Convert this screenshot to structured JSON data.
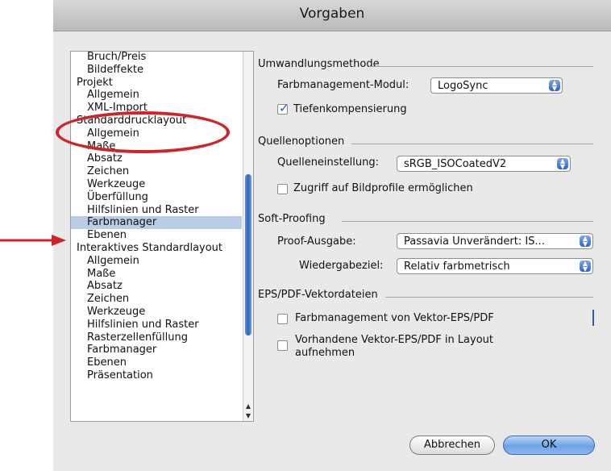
{
  "window": {
    "title": "Vorgaben"
  },
  "tree": [
    {
      "label": "Bruch/Preis",
      "level": 1
    },
    {
      "label": "Bildeffekte",
      "level": 1
    },
    {
      "label": "Projekt",
      "level": 0
    },
    {
      "label": "Allgemein",
      "level": 1
    },
    {
      "label": "XML-Import",
      "level": 1
    },
    {
      "label": "Standarddrucklayout",
      "level": 0
    },
    {
      "label": "Allgemein",
      "level": 1
    },
    {
      "label": "Maße",
      "level": 1
    },
    {
      "label": "Absatz",
      "level": 1
    },
    {
      "label": "Zeichen",
      "level": 1
    },
    {
      "label": "Werkzeuge",
      "level": 1
    },
    {
      "label": "Überfüllung",
      "level": 1
    },
    {
      "label": "Hilfslinien und Raster",
      "level": 1
    },
    {
      "label": "Farbmanager",
      "level": 1,
      "selected": true
    },
    {
      "label": "Ebenen",
      "level": 1
    },
    {
      "label": "Interaktives Standardlayout",
      "level": 0
    },
    {
      "label": "Allgemein",
      "level": 1
    },
    {
      "label": "Maße",
      "level": 1
    },
    {
      "label": "Absatz",
      "level": 1
    },
    {
      "label": "Zeichen",
      "level": 1
    },
    {
      "label": "Werkzeuge",
      "level": 1
    },
    {
      "label": "Hilfslinien und Raster",
      "level": 1
    },
    {
      "label": "Rasterzellenfüllung",
      "level": 1
    },
    {
      "label": "Farbmanager",
      "level": 1
    },
    {
      "label": "Ebenen",
      "level": 1
    },
    {
      "label": "Präsentation",
      "level": 1
    }
  ],
  "conversion": {
    "heading": "Umwandlungsmethode",
    "module_label": "Farbmanagement-Modul:",
    "module_value": "LogoSync",
    "depth_comp_label": "Tiefenkompensierung",
    "depth_comp_checked": true
  },
  "source": {
    "heading": "Quellenoptionen",
    "setting_label": "Quelleneinstellung:",
    "setting_value": "sRGB_ISOCoatedV2",
    "profile_access_label": "Zugriff auf Bildprofile ermöglichen",
    "profile_access_checked": false
  },
  "softproof": {
    "heading": "Soft-Proofing",
    "output_label": "Proof-Ausgabe:",
    "output_value": "Passavia Unverändert: IS...",
    "intent_label": "Wiedergabeziel:",
    "intent_value": "Relativ farbmetrisch"
  },
  "eps": {
    "heading": "EPS/PDF-Vektordateien",
    "cm_label": "Farbmanagement von Vektor-EPS/PDF",
    "cm_checked": false,
    "include_label_line1": "Vorhandene Vektor-EPS/PDF in Layout",
    "include_label_line2": "aufnehmen",
    "include_checked": false
  },
  "buttons": {
    "cancel": "Abbrechen",
    "ok": "OK"
  },
  "annotation_color": "#d0232a"
}
